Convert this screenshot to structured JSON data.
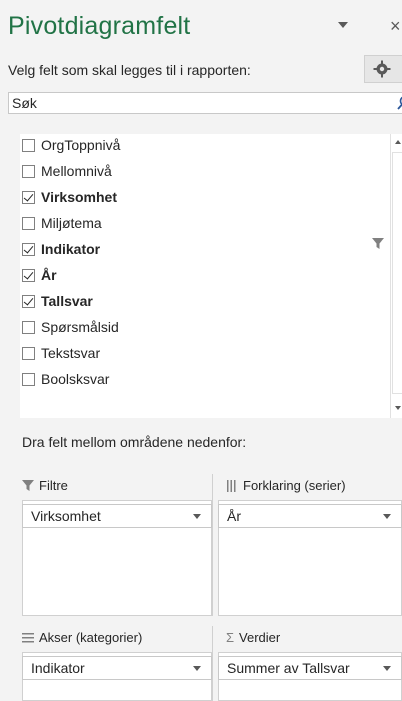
{
  "pane": {
    "title": "Pivotdiagramfelt",
    "subtitle": "Velg felt som skal legges til i rapporten:",
    "close_glyph": "×",
    "icons": {
      "dropdown": "chevron-down-icon",
      "close": "close-icon",
      "settings": "gear-icon",
      "search": "search-icon"
    }
  },
  "search": {
    "placeholder": "Søk",
    "value": ""
  },
  "fields": [
    {
      "label": "OrgToppnivå",
      "checked": false
    },
    {
      "label": "Mellomnivå",
      "checked": false
    },
    {
      "label": "Virksomhet",
      "checked": true
    },
    {
      "label": "Miljøtema",
      "checked": false
    },
    {
      "label": "Indikator",
      "checked": true
    },
    {
      "label": "År",
      "checked": true
    },
    {
      "label": "Tallsvar",
      "checked": true
    },
    {
      "label": "Spørsmålsid",
      "checked": false
    },
    {
      "label": "Tekstsvar",
      "checked": false
    },
    {
      "label": "Boolsksvar",
      "checked": false
    }
  ],
  "areas_heading": "Dra felt mellom områdene nedenfor:",
  "areas": {
    "filters": {
      "label": "Filtre",
      "icon": "filter-icon",
      "items": [
        "Virksomhet"
      ]
    },
    "legend": {
      "label": "Forklaring (serier)",
      "icon": "columns-icon",
      "items": [
        "År"
      ]
    },
    "axis": {
      "label": "Akser (kategorier)",
      "icon": "rows-icon",
      "items": [
        "Indikator"
      ]
    },
    "values": {
      "label": "Verdier",
      "icon": "sigma-icon",
      "items": [
        "Summer av Tallsvar"
      ]
    }
  }
}
